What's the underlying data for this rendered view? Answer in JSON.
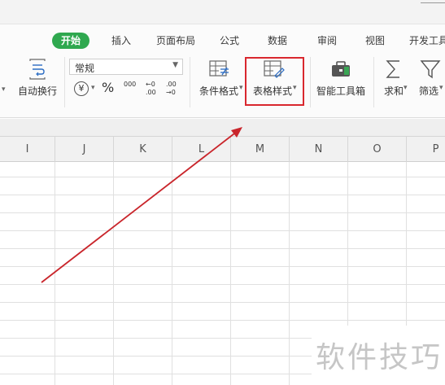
{
  "tabs": [
    "开始",
    "插入",
    "页面布局",
    "公式",
    "数据",
    "审阅",
    "视图",
    "开发工具"
  ],
  "ribbon": {
    "wrap_text": "自动换行",
    "number_format": "常规",
    "currency_symbol": "¥",
    "percent_symbol": "%",
    "thousands_symbol": "000",
    "increase_decimal": "←0 .00",
    "decrease_decimal": ".00 →0",
    "conditional_format": "条件格式",
    "table_style": "表格样式",
    "smart_toolbox": "智能工具箱",
    "sum": "求和",
    "filter": "筛选"
  },
  "columns": [
    "I",
    "J",
    "K",
    "L",
    "M",
    "N",
    "O",
    "P"
  ],
  "watermark": "软件技巧",
  "colors": {
    "accent": "#2fa84f",
    "highlight": "#d9272e",
    "arrow": "#c9252b"
  }
}
